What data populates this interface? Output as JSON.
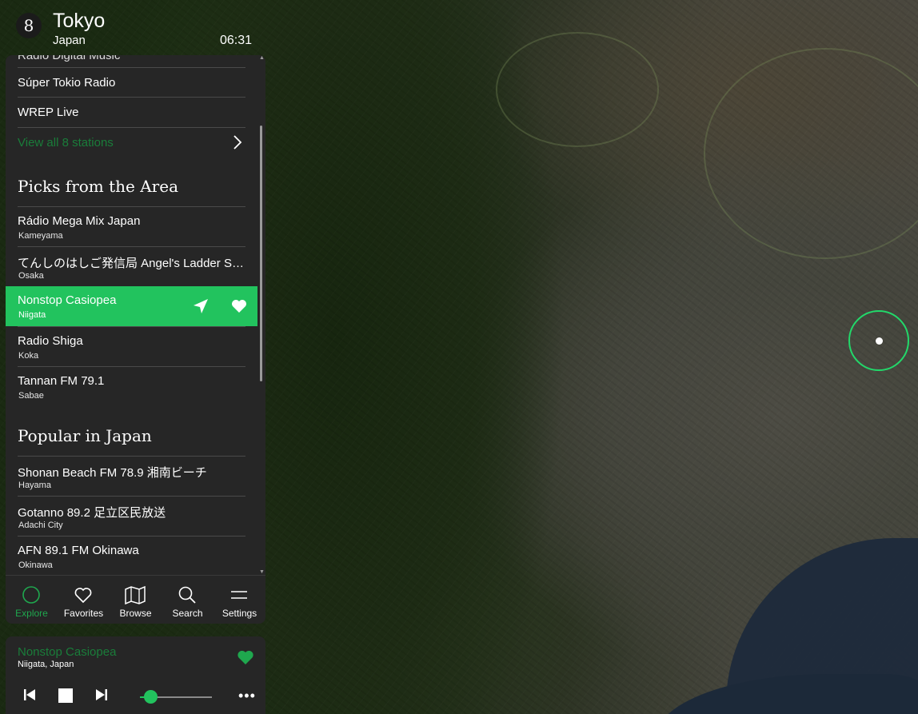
{
  "header": {
    "badge_count": "8",
    "city": "Tokyo",
    "country": "Japan",
    "time": "06:31"
  },
  "panel": {
    "cut_row": "Radio Digital Music",
    "local_stations": [
      {
        "name": "Súper Tokio Radio"
      },
      {
        "name": "WREP Live"
      }
    ],
    "view_all_label": "View all 8 stations",
    "picks": {
      "title": "Picks from the Area",
      "stations": [
        {
          "name": "Rádio Mega Mix Japan",
          "city": "Kameyama"
        },
        {
          "name": "てんしのはしご発信局 Angel's Ladder Station",
          "city": "Osaka"
        },
        {
          "name": "Nonstop Casiopea",
          "city": "Niigata",
          "active": true
        },
        {
          "name": "Radio Shiga",
          "city": "Koka"
        },
        {
          "name": "Tannan FM 79.1",
          "city": "Sabae"
        }
      ]
    },
    "popular": {
      "title": "Popular in Japan",
      "stations": [
        {
          "name": "Shonan Beach FM 78.9 湘南ビーチ",
          "city": "Hayama"
        },
        {
          "name": "Gotanno 89.2 足立区民放送",
          "city": "Adachi City"
        },
        {
          "name": "AFN 89.1 FM Okinawa",
          "city": "Okinawa"
        }
      ]
    }
  },
  "nav": {
    "items": [
      {
        "label": "Explore",
        "icon": "explore-icon",
        "active": true
      },
      {
        "label": "Favorites",
        "icon": "heart-icon"
      },
      {
        "label": "Browse",
        "icon": "map-icon"
      },
      {
        "label": "Search",
        "icon": "search-icon"
      },
      {
        "label": "Settings",
        "icon": "menu-icon"
      }
    ]
  },
  "player": {
    "title": "Nonstop Casiopea",
    "subtitle": "Niigata, Japan",
    "volume": 0.15,
    "more_label": "•••"
  },
  "colors": {
    "accent": "#22c35e",
    "accent_text": "#1a7d3a",
    "panel_bg": "#262626"
  }
}
